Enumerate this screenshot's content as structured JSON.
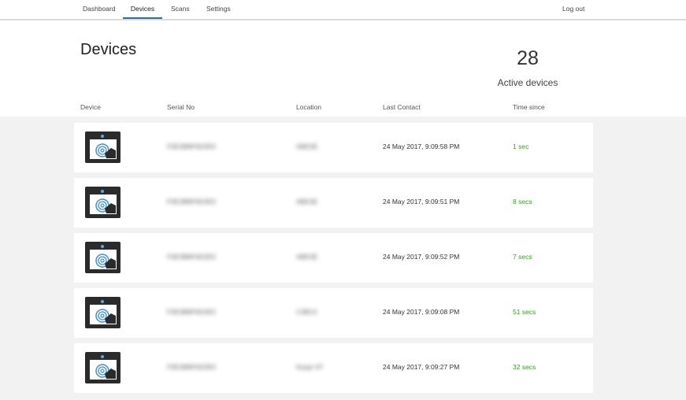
{
  "nav": {
    "items": [
      "Dashboard",
      "Devices",
      "Scans",
      "Settings"
    ],
    "active": "Devices",
    "logout": "Log out"
  },
  "page": {
    "title": "Devices",
    "active_count": "28",
    "active_label": "Active devices"
  },
  "columns": [
    "Device",
    "Serial No",
    "Location",
    "Last Contact",
    "Time since"
  ],
  "devices": [
    {
      "serial": "F0E3B8F6D2E0",
      "location": "ABE3E",
      "last_contact": "24 May 2017, 9:09:58 PM",
      "time_since": "1 sec"
    },
    {
      "serial": "F0E3B8F6D2E0",
      "location": "ABE3E",
      "last_contact": "24 May 2017, 9:09:51 PM",
      "time_since": "8 secs"
    },
    {
      "serial": "F0E3B8F6D2E0",
      "location": "ABE3E",
      "last_contact": "24 May 2017, 9:09:52 PM",
      "time_since": "7 secs"
    },
    {
      "serial": "F0E3B8F6D2E0",
      "location": "C3B1X",
      "last_contact": "24 May 2017, 9:09:08 PM",
      "time_since": "51 secs"
    },
    {
      "serial": "F0E3B8F6D2E0",
      "location": "Kazpr 6T",
      "last_contact": "24 May 2017, 9:09:27 PM",
      "time_since": "32 secs"
    }
  ],
  "colors": {
    "accent": "#2a6fa8",
    "status_green": "#3a9a28",
    "device_dot": "#5aa8e6"
  },
  "icons": {
    "device": "fingerprint-scanner-icon"
  }
}
